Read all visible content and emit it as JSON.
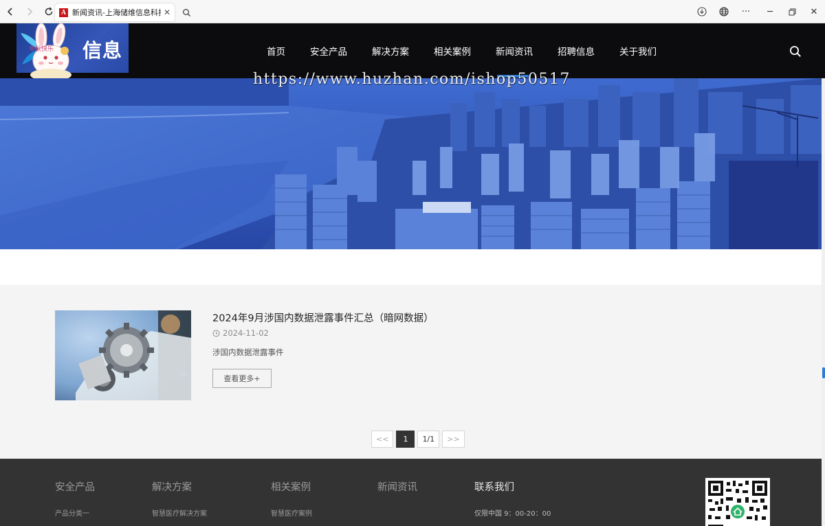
{
  "browser": {
    "tab_title": "新闻资讯-上海储维信息科技有限公司",
    "tab_favicon_letter": "A"
  },
  "header": {
    "logo_text": "信息",
    "bunny_text": "中秋快乐",
    "nav": [
      {
        "label": "首页"
      },
      {
        "label": "安全产品"
      },
      {
        "label": "解决方案"
      },
      {
        "label": "相关案例"
      },
      {
        "label": "新闻资讯"
      },
      {
        "label": "招聘信息"
      },
      {
        "label": "关于我们"
      }
    ],
    "active_nav": "新闻资讯"
  },
  "hero": {
    "watermark": "https://www.huzhan.com/ishop50517"
  },
  "news": {
    "items": [
      {
        "title": "2024年9月涉国内数据泄露事件汇总（暗网数据）",
        "date": "2024-11-02",
        "desc": "涉国内数据泄露事件",
        "more_label": "查看更多+"
      }
    ]
  },
  "pagination": {
    "prev": "<<",
    "current": "1",
    "total": "1/1",
    "next": ">>"
  },
  "footer": {
    "cols": [
      {
        "heading": "安全产品",
        "link": "产品分类一"
      },
      {
        "heading": "解决方案",
        "link": "智慧医疗解决方案"
      },
      {
        "heading": "相关案例",
        "link": "智慧医疗案例"
      },
      {
        "heading": "新闻资讯",
        "link": ""
      },
      {
        "heading": "联系我们",
        "link": "仅限中国 9：00-20：00"
      }
    ]
  },
  "colors": {
    "header_bg": "#0c0c0f",
    "accent": "#2f7dd8",
    "footer_bg": "#333333",
    "section_bg": "#f4f4f4"
  }
}
